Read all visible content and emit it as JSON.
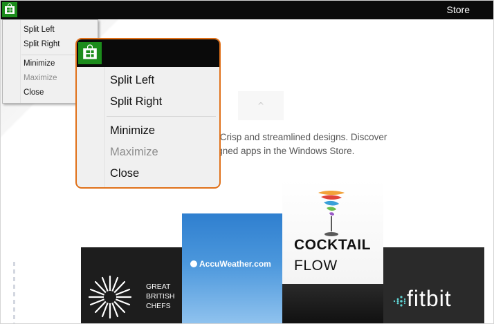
{
  "window": {
    "title": "Store",
    "icon": "store-icon"
  },
  "content": {
    "description_line1": "hy. Crisp and streamlined designs. Discover",
    "description_line2": "esigned apps in the Windows Store.",
    "scroll_up_glyph": "^"
  },
  "tiles": {
    "gbc": {
      "line1": "GREAT",
      "line2": "BRITISH",
      "line3": "CHEFS"
    },
    "accuweather": {
      "text": "AccuWeather.com"
    },
    "cocktail": {
      "line1": "COCKTAIL",
      "line2": "FLOW"
    },
    "fitbit": {
      "text": "fitbit"
    }
  },
  "system_menu": {
    "items": [
      {
        "label": "Split Left",
        "enabled": true
      },
      {
        "label": "Split Right",
        "enabled": true
      },
      {
        "label": "Minimize",
        "enabled": true
      },
      {
        "label": "Maximize",
        "enabled": false
      },
      {
        "label": "Close",
        "enabled": true
      }
    ]
  },
  "colors": {
    "titlebar": "#0a0a0a",
    "store_green": "#1c8c1c",
    "highlight_outline": "#e07018",
    "menu_bg": "#f0f0f0",
    "disabled_text": "#8c8c8c"
  }
}
